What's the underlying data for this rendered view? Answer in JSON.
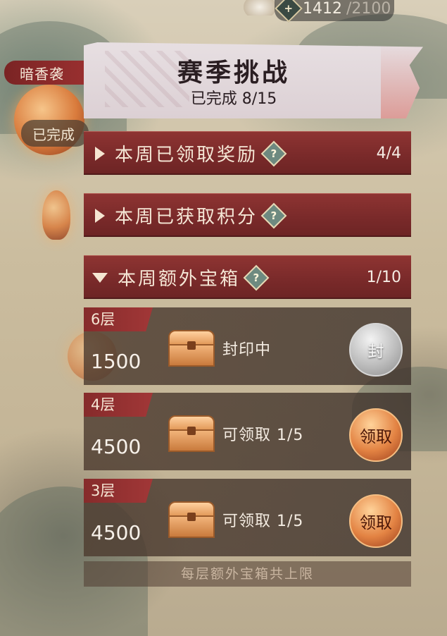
{
  "currency": {
    "icon": "plus-diamond-icon",
    "current": "1412",
    "max": "/2100",
    "plus_glyph": "+"
  },
  "map": {
    "region_tab": "暗香袭",
    "done_label": "已完成"
  },
  "panel": {
    "title": "赛季挑战",
    "subtitle": "已完成 8/15",
    "rows": [
      {
        "label": "本周已领取奖励",
        "count": "4/4",
        "expanded": false
      },
      {
        "label": "本周已获取积分",
        "count": "",
        "expanded": false
      },
      {
        "label": "本周额外宝箱",
        "count": "1/10",
        "expanded": true
      }
    ],
    "help_glyph": "?",
    "layers": [
      {
        "layer": "6层",
        "value": "1500",
        "status": "封印中",
        "button": "封",
        "state": "sealed"
      },
      {
        "layer": "4层",
        "value": "4500",
        "status": "可领取 1/5",
        "button": "领取",
        "state": "claimable"
      },
      {
        "layer": "3层",
        "value": "4500",
        "status": "可领取 1/5",
        "button": "领取",
        "state": "claimable"
      }
    ],
    "footer": "每层额外宝箱共上限"
  },
  "colors": {
    "row_red": "#7a2a2a",
    "claim_orange": "#e38343",
    "sealed_gray": "#bdbdbd"
  }
}
